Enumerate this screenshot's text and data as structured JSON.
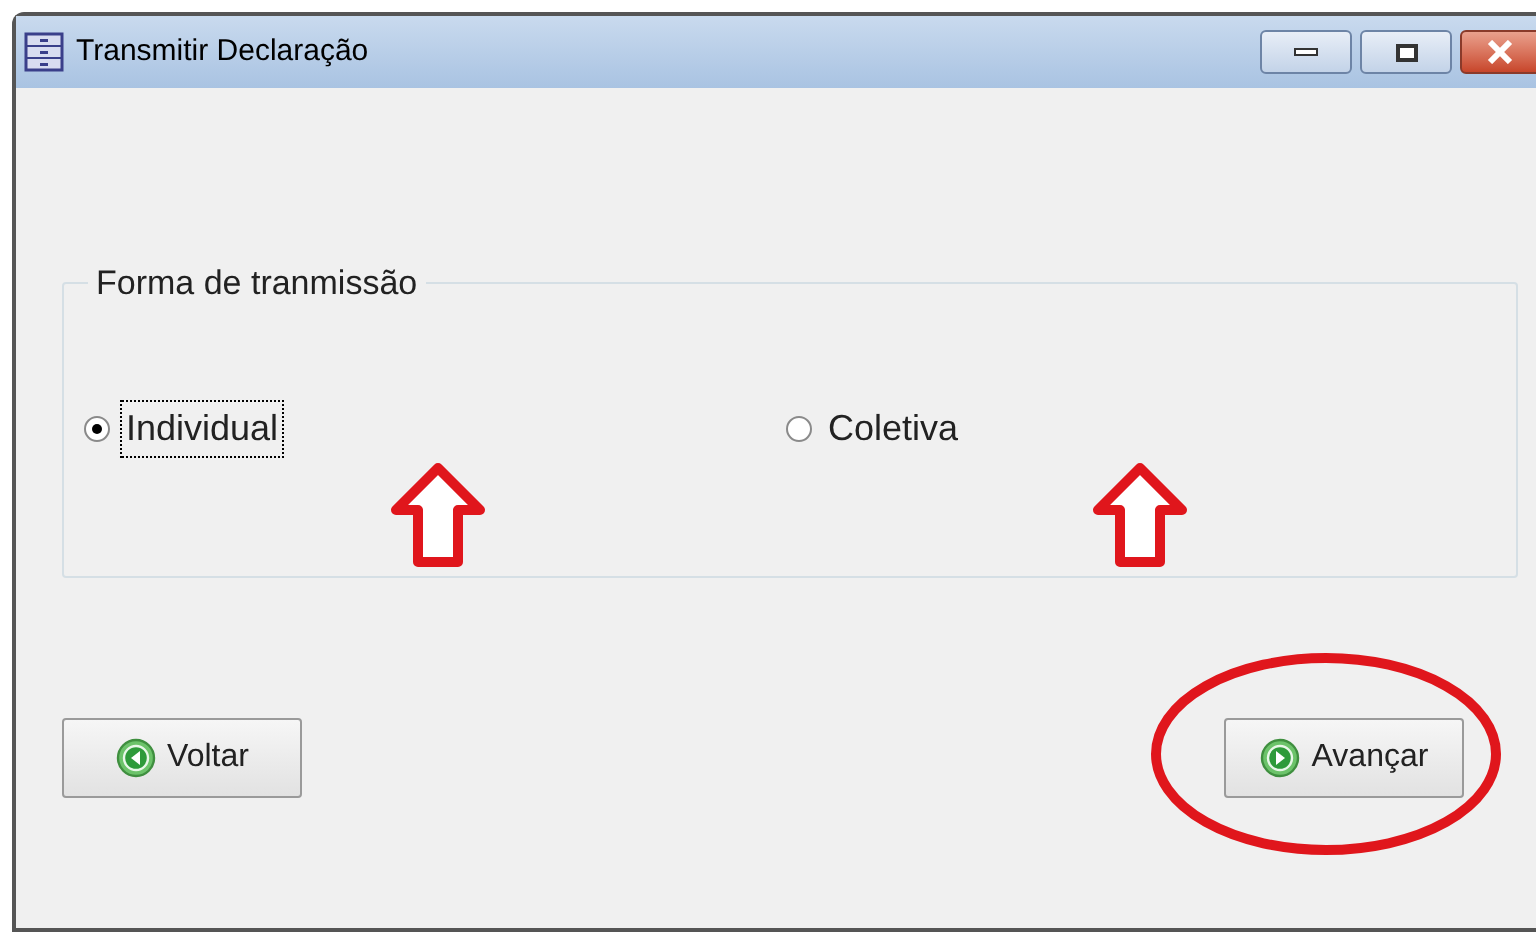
{
  "window": {
    "title": "Transmitir Declaração"
  },
  "group": {
    "legend": "Forma de tranmissão",
    "options": [
      {
        "label": "Individual",
        "selected": true
      },
      {
        "label": "Coletiva",
        "selected": false
      }
    ]
  },
  "buttons": [
    {
      "label": "Voltar",
      "kind": "back"
    },
    {
      "label": "Avançar",
      "kind": "next"
    }
  ]
}
